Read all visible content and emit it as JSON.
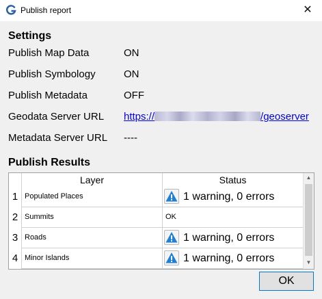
{
  "window": {
    "title": "Publish report",
    "close_glyph": "✕"
  },
  "settings": {
    "heading": "Settings",
    "rows": [
      {
        "label": "Publish Map Data",
        "value": "ON"
      },
      {
        "label": "Publish Symbology",
        "value": "ON"
      },
      {
        "label": "Publish Metadata",
        "value": "OFF"
      },
      {
        "label": "Geodata Server URL",
        "value_prefix": "https://",
        "value_suffix": "/geoserver"
      },
      {
        "label": "Metadata Server URL",
        "value": "----"
      }
    ]
  },
  "results": {
    "heading": "Publish Results",
    "columns": [
      "Layer",
      "Status"
    ],
    "rows": [
      {
        "num": "1",
        "layer": "Populated Places",
        "status": "1 warning, 0 errors",
        "icon": "warning-icon"
      },
      {
        "num": "2",
        "layer": "Summits",
        "status": "OK",
        "icon": ""
      },
      {
        "num": "3",
        "layer": "Roads",
        "status": "1 warning, 0 errors",
        "icon": "warning-icon"
      },
      {
        "num": "4",
        "layer": "Minor Islands",
        "status": "1 warning, 0 errors",
        "icon": "warning-icon"
      }
    ]
  },
  "ok_button": "OK",
  "colors": {
    "link": "#0000ee",
    "warning_fill": "#1e7fd6",
    "focus_border": "#0078d7"
  }
}
